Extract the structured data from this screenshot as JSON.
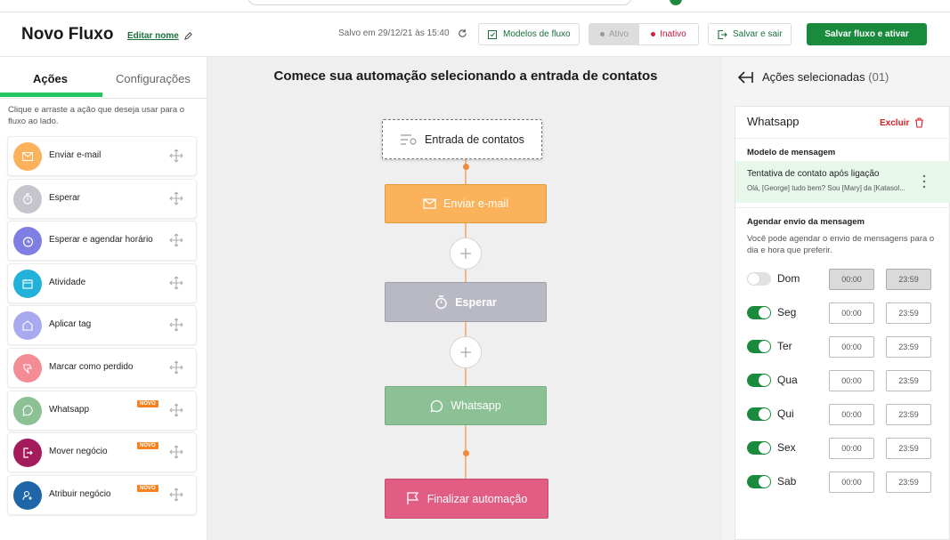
{
  "header": {
    "title": "Novo Fluxo",
    "edit_name": "Editar nome",
    "saved_status": "Salvo em 29/12/21 às 15:40",
    "models_button": "Modelos de fluxo",
    "status_active": "Ativo",
    "status_inactive": "Inativo",
    "save_exit_button": "Salvar e sair",
    "save_activate_button": "Salvar fluxo e ativar"
  },
  "left_panel": {
    "tabs": [
      "Ações",
      "Configurações"
    ],
    "active_tab": "Ações",
    "help_text": "Clique e arraste a ação que deseja usar para o fluxo ao lado.",
    "actions": [
      {
        "label": "Enviar e-mail",
        "icon": "envelope-icon",
        "color": "#fbb25a"
      },
      {
        "label": "Esperar",
        "icon": "timer-icon",
        "color": "#c5c5cd"
      },
      {
        "label": "Esperar e agendar horário",
        "icon": "schedule-icon",
        "color": "#7f7fe3"
      },
      {
        "label": "Atividade",
        "icon": "calendar-icon",
        "color": "#22b1d8"
      },
      {
        "label": "Aplicar tag",
        "icon": "tag-icon",
        "color": "#a9a9ef"
      },
      {
        "label": "Marcar como perdido",
        "icon": "thumbs-down-icon",
        "color": "#f38c94"
      },
      {
        "label": "Whatsapp",
        "icon": "whatsapp-icon",
        "color": "#8cc196",
        "badge": "NOVO"
      },
      {
        "label": "Mover negócio",
        "icon": "move-icon",
        "color": "#a31b5b",
        "badge": "NOVO"
      },
      {
        "label": "Atribuir negócio",
        "icon": "assign-user-icon",
        "color": "#1f66a8",
        "badge": "NOVO"
      }
    ]
  },
  "canvas": {
    "title": "Comece  sua automação selecionando a entrada de contatos",
    "nodes": {
      "entry": "Entrada de contatos",
      "email": "Enviar e-mail",
      "wait": "Esperar",
      "whatsapp": "Whatsapp",
      "end": "Finalizar automação"
    }
  },
  "right_panel": {
    "header_label": "Ações selecionadas",
    "header_count": "(01)",
    "card": {
      "title": "Whatsapp",
      "delete_label": "Excluir",
      "template_section": "Modelo de mensagem",
      "template_title": "Tentativa de contato após ligação",
      "template_preview": "Olá, [George] tudo bem? Sou [Mary] da [Katasol...",
      "schedule_section": "Agendar envio da mensagem",
      "schedule_description": "Você pode agendar o envio de mensagens para o dia e hora que preferir.",
      "days": [
        {
          "name": "Dom",
          "enabled": false,
          "start": "00:00",
          "end": "23:59"
        },
        {
          "name": "Seg",
          "enabled": true,
          "start": "00:00",
          "end": "23:59"
        },
        {
          "name": "Ter",
          "enabled": true,
          "start": "00:00",
          "end": "23:59"
        },
        {
          "name": "Qua",
          "enabled": true,
          "start": "00:00",
          "end": "23:59"
        },
        {
          "name": "Qui",
          "enabled": true,
          "start": "00:00",
          "end": "23:59"
        },
        {
          "name": "Sex",
          "enabled": true,
          "start": "00:00",
          "end": "23:59"
        },
        {
          "name": "Sab",
          "enabled": true,
          "start": "00:00",
          "end": "23:59"
        }
      ]
    }
  }
}
